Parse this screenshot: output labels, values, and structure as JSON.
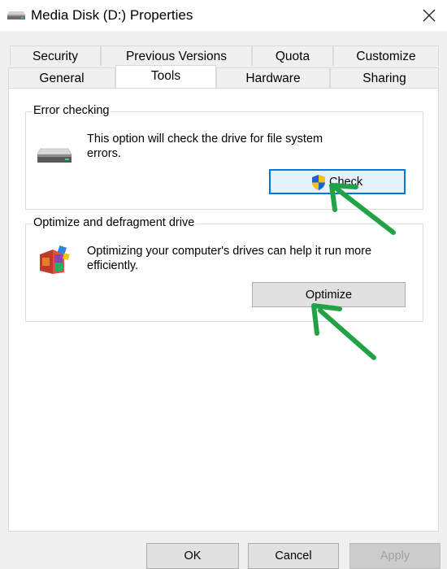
{
  "window": {
    "title": "Media Disk (D:) Properties",
    "icon": "drive-icon",
    "close_icon": "close-icon"
  },
  "tabs": {
    "row1": [
      "Security",
      "Previous Versions",
      "Quota",
      "Customize"
    ],
    "row2": [
      "General",
      "Tools",
      "Hardware",
      "Sharing"
    ],
    "active": "Tools"
  },
  "error_checking": {
    "group_label": "Error checking",
    "description": "This option will check the drive for file system errors.",
    "button_label": "Check",
    "icon": "hard-drive-icon",
    "button_icon": "uac-shield-icon"
  },
  "optimize": {
    "group_label": "Optimize and defragment drive",
    "description": "Optimizing your computer's drives can help it run more efficiently.",
    "button_label": "Optimize",
    "icon": "defrag-icon"
  },
  "footer": {
    "ok_label": "OK",
    "cancel_label": "Cancel",
    "apply_label": "Apply"
  },
  "colors": {
    "accent": "#0078d7",
    "annotation_arrow": "#21a345"
  }
}
